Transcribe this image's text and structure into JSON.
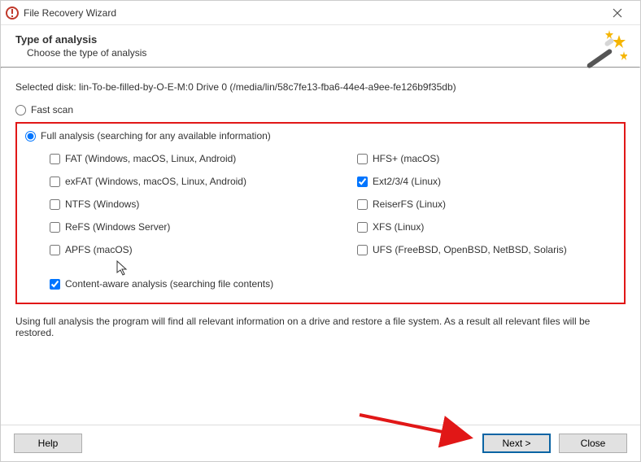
{
  "window": {
    "title": "File Recovery Wizard",
    "close_label": "Close window"
  },
  "header": {
    "title": "Type of analysis",
    "subtitle": "Choose the type of analysis"
  },
  "selected_disk": "Selected disk: lin-To-be-filled-by-O-E-M:0 Drive 0 (/media/lin/58c7fe13-fba6-44e4-a9ee-fe126b9f35db)",
  "options": {
    "fast_label": "Fast scan",
    "full_label": "Full analysis (searching for any available information)",
    "selected": "full"
  },
  "filesystems": {
    "left": [
      {
        "label": "FAT (Windows, macOS, Linux, Android)",
        "checked": false
      },
      {
        "label": "exFAT (Windows, macOS, Linux, Android)",
        "checked": false
      },
      {
        "label": "NTFS (Windows)",
        "checked": false
      },
      {
        "label": "ReFS (Windows Server)",
        "checked": false
      },
      {
        "label": "APFS (macOS)",
        "checked": false
      }
    ],
    "right": [
      {
        "label": "HFS+ (macOS)",
        "checked": false
      },
      {
        "label": "Ext2/3/4 (Linux)",
        "checked": true
      },
      {
        "label": "ReiserFS (Linux)",
        "checked": false
      },
      {
        "label": "XFS (Linux)",
        "checked": false
      },
      {
        "label": "UFS (FreeBSD, OpenBSD, NetBSD, Solaris)",
        "checked": false
      }
    ]
  },
  "content_aware": {
    "label": "Content-aware analysis (searching file contents)",
    "checked": true
  },
  "note": "Using full analysis the program will find all relevant information on a drive and restore a file system. As a result all relevant files will be restored.",
  "buttons": {
    "help": "Help",
    "next": "Next >",
    "close": "Close"
  }
}
